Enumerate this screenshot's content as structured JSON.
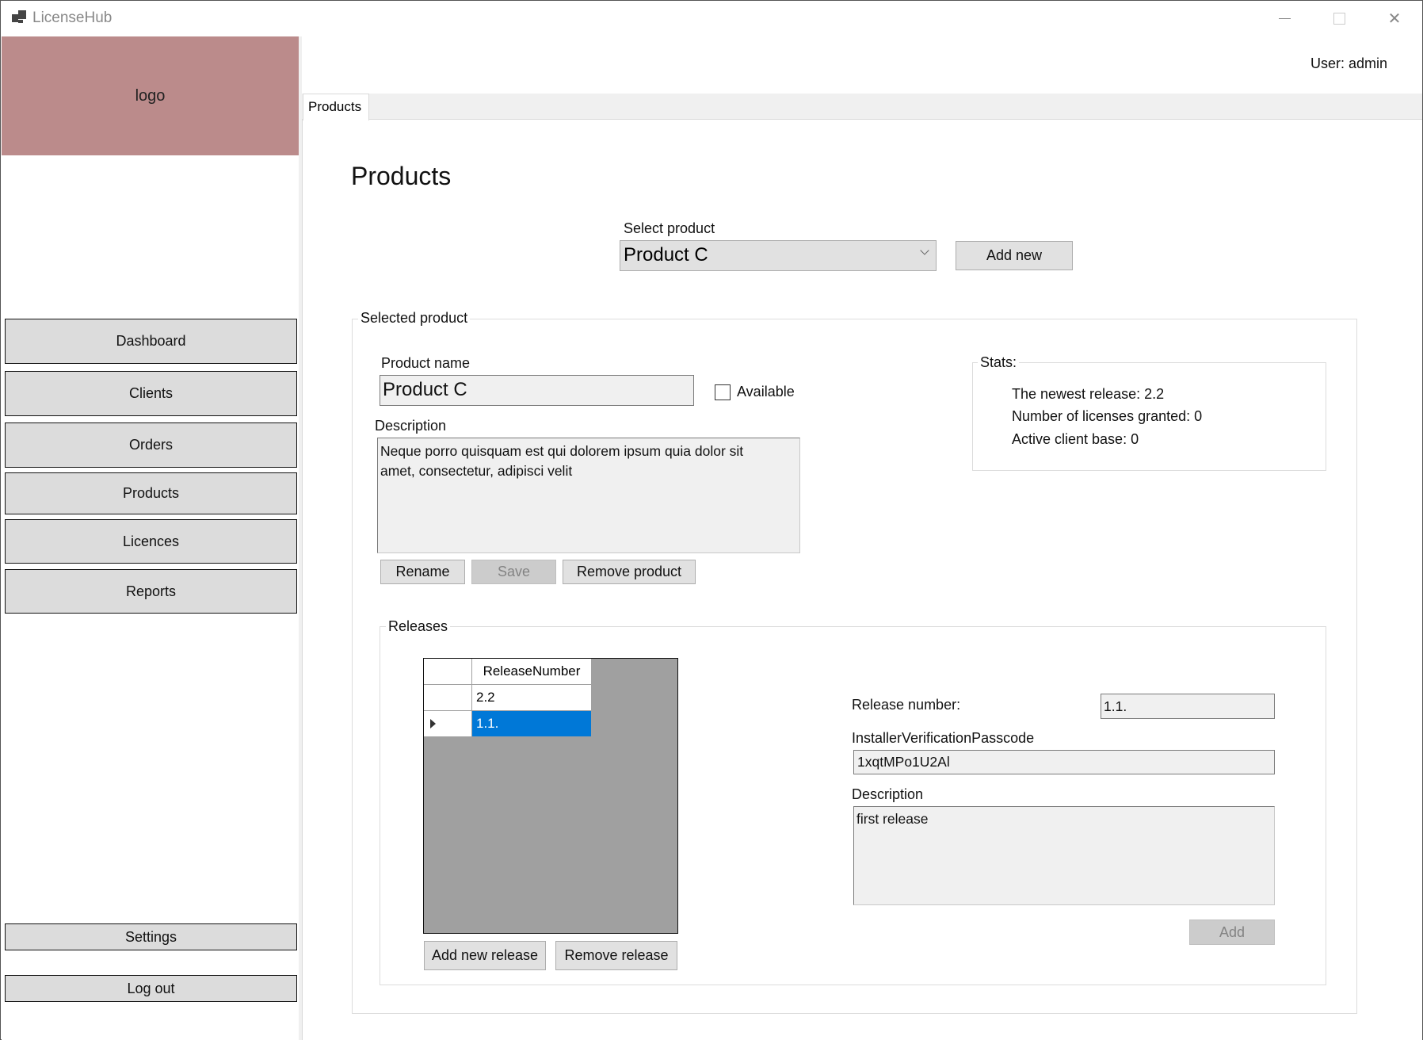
{
  "window": {
    "title": "LicenseHub",
    "controls": {
      "minimize": "—",
      "maximize": "□",
      "close": "✕"
    }
  },
  "sidebar": {
    "logo_text": "logo",
    "logo_color": "#bb8b8b",
    "nav": [
      {
        "label": "Dashboard"
      },
      {
        "label": "Clients"
      },
      {
        "label": "Orders"
      },
      {
        "label": "Products"
      },
      {
        "label": "Licences"
      },
      {
        "label": "Reports"
      }
    ],
    "settings_label": "Settings",
    "logout_label": "Log out"
  },
  "header": {
    "user_label": "User: admin"
  },
  "tabs": [
    {
      "label": "Products",
      "active": true
    }
  ],
  "products_page": {
    "title": "Products",
    "select_product_label": "Select product",
    "selected_product_value": "Product C",
    "add_new_label": "Add new",
    "selected_product_group": {
      "title": "Selected product",
      "product_name_label": "Product name",
      "product_name_value": "Product C",
      "available_label": "Available",
      "available_checked": false,
      "description_label": "Description",
      "description_value": "Neque porro quisquam est qui dolorem ipsum quia dolor sit amet, consectetur, adipisci velit",
      "rename_label": "Rename",
      "save_label": "Save",
      "remove_product_label": "Remove product"
    },
    "stats": {
      "title": "Stats:",
      "lines": [
        "The newest release: 2.2",
        "Number of licenses granted: 0",
        "Active client base: 0"
      ]
    },
    "releases": {
      "title": "Releases",
      "grid": {
        "column_header": "ReleaseNumber",
        "rows": [
          {
            "value": "2.2",
            "selected": false
          },
          {
            "value": "1.1.",
            "selected": true
          }
        ]
      },
      "add_new_release_label": "Add new release",
      "remove_release_label": "Remove release",
      "release_number_label": "Release number:",
      "release_number_value": "1.1.",
      "passcode_label": "InstallerVerificationPasscode",
      "passcode_value": "1xqtMPo1U2Al",
      "description_label": "Description",
      "description_value": "first release",
      "add_label": "Add"
    }
  },
  "colors": {
    "selection": "#0078d7",
    "button_bg": "#e1e1e1",
    "nav_button_bg": "#dcdcdc",
    "grid_bg": "#a0a0a0"
  }
}
